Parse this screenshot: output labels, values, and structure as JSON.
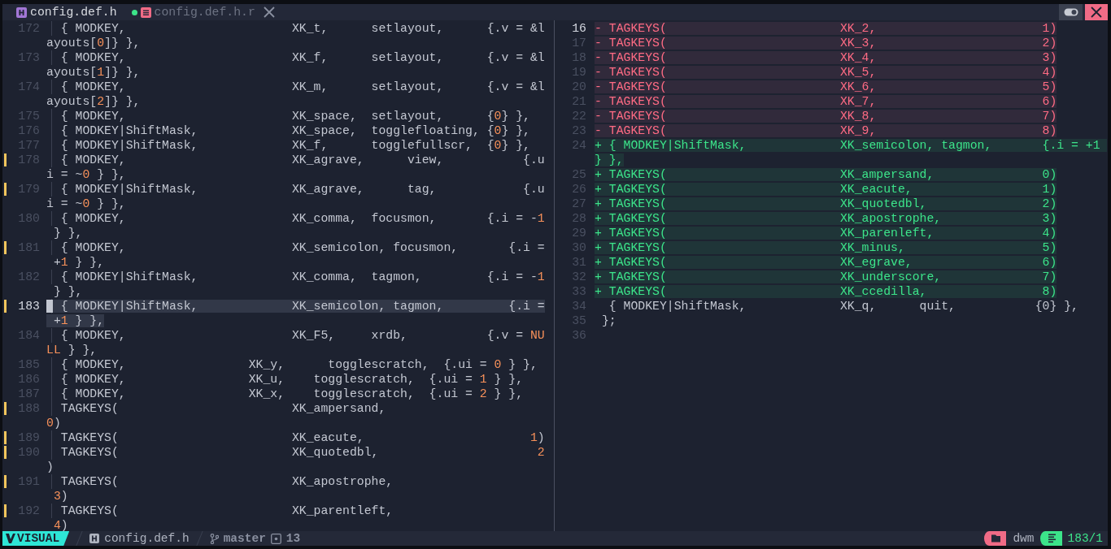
{
  "tabs": [
    {
      "label": "config.def.h",
      "selected": true,
      "modified": true,
      "close_button": false
    },
    {
      "label": "config.def.h.r",
      "selected": false,
      "modified": false,
      "close_button": true
    }
  ],
  "panes": [
    {
      "kind": "source",
      "lines": [
        {
          "number": "172",
          "text": "  { MODKEY,                       XK_t,      setlayout,      {.v = &layouts[0]} },",
          "changed": false,
          "current": false,
          "selected": false
        },
        {
          "number": "173",
          "text": "  { MODKEY,                       XK_f,      setlayout,      {.v = &layouts[1]} },",
          "changed": false,
          "current": false,
          "selected": false
        },
        {
          "number": "174",
          "text": "  { MODKEY,                       XK_m,      setlayout,      {.v = &layouts[2]} },",
          "changed": false,
          "current": false,
          "selected": false
        },
        {
          "number": "175",
          "text": "  { MODKEY,                       XK_space,  setlayout,      {0} },",
          "changed": false,
          "current": false,
          "selected": false
        },
        {
          "number": "176",
          "text": "  { MODKEY|ShiftMask,             XK_space,  togglefloating, {0} },",
          "changed": false,
          "current": false,
          "selected": false
        },
        {
          "number": "177",
          "text": "  { MODKEY|ShiftMask,             XK_f,      togglefullscr,  {0} },",
          "changed": false,
          "current": false,
          "selected": false
        },
        {
          "number": "178",
          "text": "  { MODKEY,                       XK_agrave,      view,           {.ui = ~0 } },",
          "changed": true,
          "current": false,
          "selected": false
        },
        {
          "number": "179",
          "text": "  { MODKEY|ShiftMask,             XK_agrave,      tag,            {.ui = ~0 } },",
          "changed": true,
          "current": false,
          "selected": false
        },
        {
          "number": "180",
          "text": "  { MODKEY,                       XK_comma,  focusmon,       {.i = -1 } },",
          "changed": false,
          "current": false,
          "selected": false
        },
        {
          "number": "181",
          "text": "  { MODKEY,                       XK_semicolon, focusmon,       {.i = +1 } },",
          "changed": true,
          "current": false,
          "selected": false
        },
        {
          "number": "182",
          "text": "  { MODKEY|ShiftMask,             XK_comma,  tagmon,         {.i = -1 } },",
          "changed": false,
          "current": false,
          "selected": false
        },
        {
          "number": "183",
          "text": "  { MODKEY|ShiftMask,             XK_semicolon, tagmon,         {.i = +1 } },",
          "changed": true,
          "current": true,
          "selected": true
        },
        {
          "number": "184",
          "text": "  { MODKEY,                       XK_F5,     xrdb,           {.v = NULL } },",
          "changed": false,
          "current": false,
          "selected": false
        },
        {
          "number": "185",
          "text": "  { MODKEY,                 XK_y,      togglescratch,  {.ui = 0 } },",
          "changed": false,
          "current": false,
          "selected": false
        },
        {
          "number": "186",
          "text": "  { MODKEY,                 XK_u,    togglescratch,  {.ui = 1 } },",
          "changed": false,
          "current": false,
          "selected": false
        },
        {
          "number": "187",
          "text": "  { MODKEY,                 XK_x,    togglescratch,  {.ui = 2 } },",
          "changed": false,
          "current": false,
          "selected": false
        },
        {
          "number": "188",
          "text": "  TAGKEYS(                        XK_ampersand,                      0)",
          "changed": true,
          "current": false,
          "selected": false
        },
        {
          "number": "189",
          "text": "  TAGKEYS(                        XK_eacute,                       1)",
          "changed": true,
          "current": false,
          "selected": false
        },
        {
          "number": "190",
          "text": "  TAGKEYS(                        XK_quotedbl,                      2)",
          "changed": true,
          "current": false,
          "selected": false
        },
        {
          "number": "191",
          "text": "  TAGKEYS(                        XK_apostrophe,                      3)",
          "changed": true,
          "current": false,
          "selected": false
        },
        {
          "number": "192",
          "text": "  TAGKEYS(                        XK_parentleft,                      4)",
          "changed": true,
          "current": false,
          "selected": false
        }
      ]
    },
    {
      "kind": "diff",
      "lines": [
        {
          "number": "16",
          "text": "- TAGKEYS(                        XK_2,                       1)",
          "kind": "deleted",
          "current": true
        },
        {
          "number": "17",
          "text": "- TAGKEYS(                        XK_3,                       2)",
          "kind": "deleted",
          "current": false
        },
        {
          "number": "18",
          "text": "- TAGKEYS(                        XK_4,                       3)",
          "kind": "deleted",
          "current": false
        },
        {
          "number": "19",
          "text": "- TAGKEYS(                        XK_5,                       4)",
          "kind": "deleted",
          "current": false
        },
        {
          "number": "20",
          "text": "- TAGKEYS(                        XK_6,                       5)",
          "kind": "deleted",
          "current": false
        },
        {
          "number": "21",
          "text": "- TAGKEYS(                        XK_7,                       6)",
          "kind": "deleted",
          "current": false
        },
        {
          "number": "22",
          "text": "- TAGKEYS(                        XK_8,                       7)",
          "kind": "deleted",
          "current": false
        },
        {
          "number": "23",
          "text": "- TAGKEYS(                        XK_9,                       8)",
          "kind": "deleted",
          "current": false
        },
        {
          "number": "24",
          "text": "+ { MODKEY|ShiftMask,             XK_semicolon, tagmon,       {.i = +1 } },",
          "kind": "added",
          "current": false
        },
        {
          "number": "25",
          "text": "+ TAGKEYS(                        XK_ampersand,               0)",
          "kind": "added",
          "current": false
        },
        {
          "number": "26",
          "text": "+ TAGKEYS(                        XK_eacute,                  1)",
          "kind": "added",
          "current": false
        },
        {
          "number": "27",
          "text": "+ TAGKEYS(                        XK_quotedbl,                2)",
          "kind": "added",
          "current": false
        },
        {
          "number": "28",
          "text": "+ TAGKEYS(                        XK_apostrophe,              3)",
          "kind": "added",
          "current": false
        },
        {
          "number": "29",
          "text": "+ TAGKEYS(                        XK_parenleft,               4)",
          "kind": "added",
          "current": false
        },
        {
          "number": "30",
          "text": "+ TAGKEYS(                        XK_minus,                   5)",
          "kind": "added",
          "current": false
        },
        {
          "number": "31",
          "text": "+ TAGKEYS(                        XK_egrave,                  6)",
          "kind": "added",
          "current": false
        },
        {
          "number": "32",
          "text": "+ TAGKEYS(                        XK_underscore,              7)",
          "kind": "added",
          "current": false
        },
        {
          "number": "33",
          "text": "+ TAGKEYS(                        XK_ccedilla,                8)",
          "kind": "added",
          "current": false
        },
        {
          "number": "34",
          "text": "  { MODKEY|ShiftMask,             XK_q,      quit,           {0} },",
          "kind": "context",
          "current": false
        },
        {
          "number": "35",
          "text": " };",
          "kind": "context",
          "current": false
        },
        {
          "number": "36",
          "current": false
        }
      ]
    }
  ],
  "status_bar": {
    "mode": "VISUAL",
    "file": "config.def.h",
    "branch": "master",
    "count": "13",
    "project": "dwm",
    "position": "183/1"
  }
}
